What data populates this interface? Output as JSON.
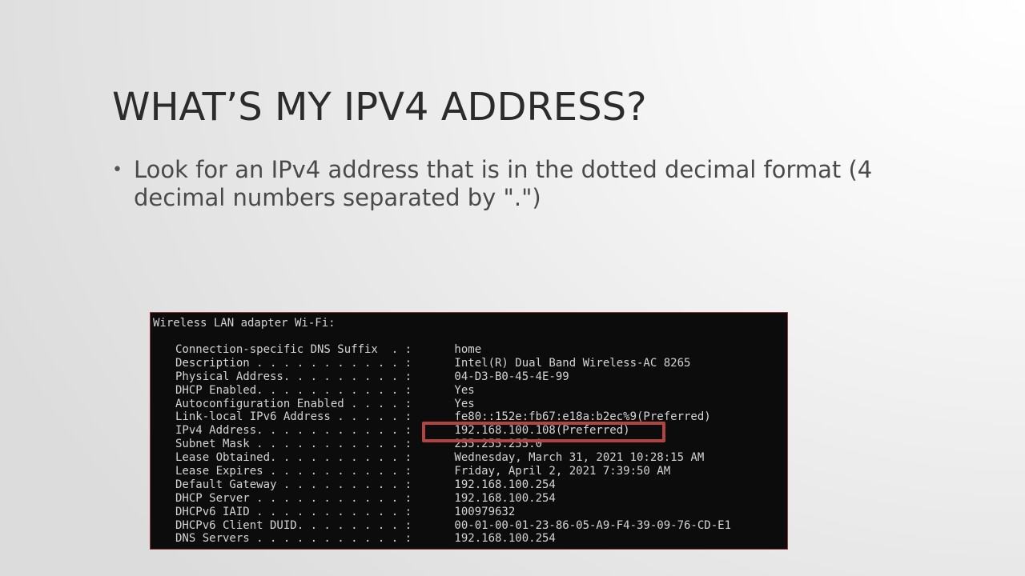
{
  "slide": {
    "title": "WHAT’S MY IPV4 ADDRESS?",
    "bullets": [
      {
        "marker": "•",
        "text": "Look for an IPv4 address that is in the dotted decimal format (4 decimal numbers separated by \".\")"
      }
    ]
  },
  "terminal": {
    "header": "Wireless LAN adapter Wi-Fi:",
    "rows": [
      {
        "key": "Connection-specific DNS Suffix  . :",
        "value": " home"
      },
      {
        "key": "Description . . . . . . . . . . . :",
        "value": " Intel(R) Dual Band Wireless-AC 8265"
      },
      {
        "key": "Physical Address. . . . . . . . . :",
        "value": " 04-D3-B0-45-4E-99"
      },
      {
        "key": "DHCP Enabled. . . . . . . . . . . :",
        "value": " Yes"
      },
      {
        "key": "Autoconfiguration Enabled . . . . :",
        "value": " Yes"
      },
      {
        "key": "Link-local IPv6 Address . . . . . :",
        "value": " fe80::152e:fb67:e18a:b2ec%9(Preferred)"
      },
      {
        "key": "IPv4 Address. . . . . . . . . . . :",
        "value": " 192.168.100.108(Preferred)"
      },
      {
        "key": "Subnet Mask . . . . . . . . . . . :",
        "value": " 255.255.255.0"
      },
      {
        "key": "Lease Obtained. . . . . . . . . . :",
        "value": " Wednesday, March 31, 2021 10:28:15 AM"
      },
      {
        "key": "Lease Expires . . . . . . . . . . :",
        "value": " Friday, April 2, 2021 7:39:50 AM"
      },
      {
        "key": "Default Gateway . . . . . . . . . :",
        "value": " 192.168.100.254"
      },
      {
        "key": "DHCP Server . . . . . . . . . . . :",
        "value": " 192.168.100.254"
      },
      {
        "key": "DHCPv6 IAID . . . . . . . . . . . :",
        "value": " 100979632"
      },
      {
        "key": "DHCPv6 Client DUID. . . . . . . . :",
        "value": " 00-01-00-01-23-86-05-A9-F4-39-09-76-CD-E1"
      },
      {
        "key": "DNS Servers . . . . . . . . . . . :",
        "value": " 192.168.100.254"
      }
    ],
    "highlighted_row": "IPv4 Address",
    "highlight_color": "#b2443f"
  }
}
